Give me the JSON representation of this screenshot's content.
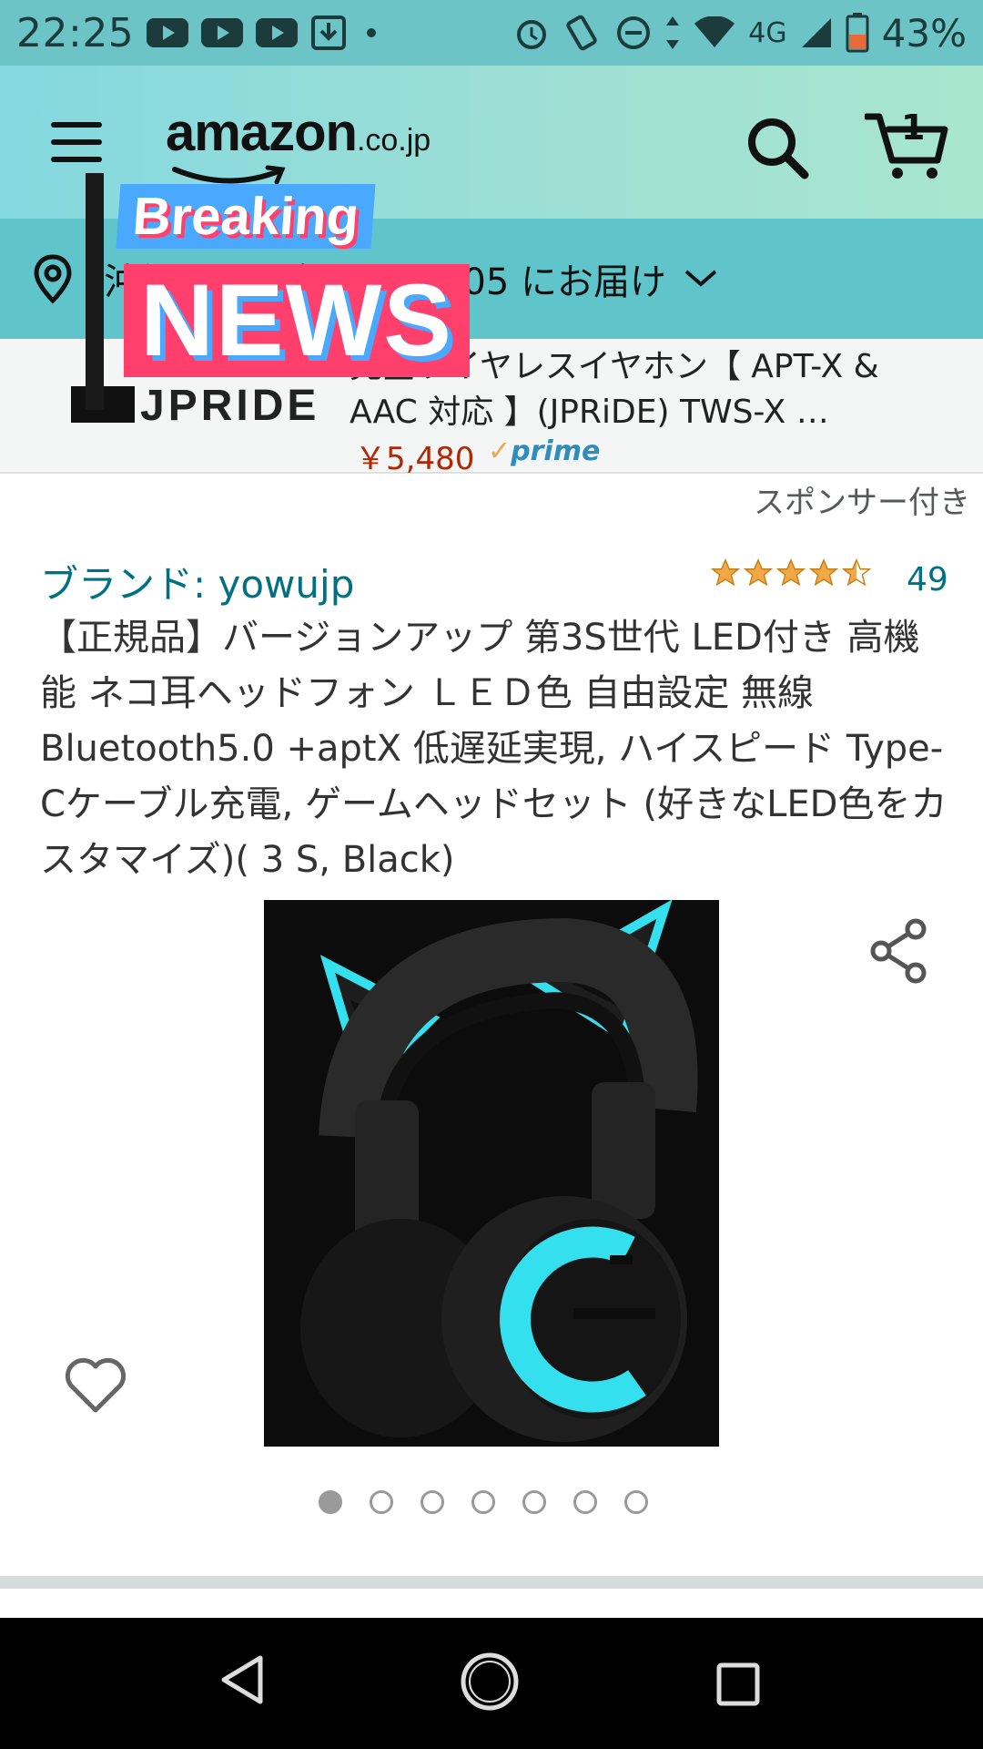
{
  "status_bar": {
    "time": "22:25",
    "network": "4G",
    "battery": "43%"
  },
  "header": {
    "logo_main": "amazon",
    "logo_tld": ".co.jp",
    "cart_count": "1"
  },
  "delivery": {
    "text": "沖縄県那覇市 900-0005 にお届け"
  },
  "sponsor_banner": {
    "brand_logo": "JPRIDE",
    "title": "完全ワイヤレスイヤホン【 APT-X & AAC 対応 】(JPRiDE) TWS-X …",
    "price": "￥5,480",
    "prime": "prime"
  },
  "sponsored_label": "スポンサー付き",
  "overlay": {
    "top": "Breaking",
    "main": "NEWS"
  },
  "product": {
    "brand": "ブランド: yowujp",
    "rating_count": "49",
    "rating_value": 4.5,
    "title": "【正規品】バージョンアップ 第3S世代 LED付き 高機能 ネコ耳ヘッドフォン ＬＥＤ色 自由設定 無線 Bluetooth5.0 +aptX 低遅延実現, ハイスピード Type-Cケーブル充電, ゲームヘッドセット (好きなLED色をカスタマイズ)( 3 S, Black)",
    "image_count": 7,
    "active_image": 1
  },
  "icons": {
    "menu": "menu-icon",
    "search": "search-icon",
    "cart": "cart-icon",
    "location": "location-pin-icon",
    "share": "share-icon",
    "wishlist": "heart-icon"
  },
  "colors": {
    "header_bg": "#84d8e0",
    "delivery_bg": "#5fc5ca",
    "link": "#007185",
    "price": "#b12704",
    "star": "#f3a847",
    "accent_led": "#35e0ee"
  }
}
